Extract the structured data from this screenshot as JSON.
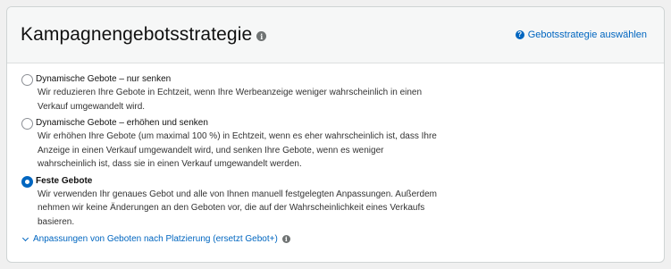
{
  "header": {
    "title": "Kampagnengebotsstrategie",
    "title_info_icon": "info-icon",
    "help_link": "Gebotsstrategie auswählen",
    "help_icon": "question-icon"
  },
  "options": [
    {
      "label": "Dynamische Gebote – nur senken",
      "selected": false,
      "description": "Wir reduzieren Ihre Gebote in Echtzeit, wenn Ihre Werbeanzeige weniger wahrscheinlich in einen Verkauf umgewandelt wird."
    },
    {
      "label": "Dynamische Gebote – erhöhen und senken",
      "selected": false,
      "description": "Wir erhöhen Ihre Gebote (um maximal 100 %) in Echtzeit, wenn es eher wahrscheinlich ist, dass Ihre Anzeige in einen Verkauf umgewandelt wird, und senken Ihre Gebote, wenn es weniger wahrscheinlich ist, dass sie in einen Verkauf umgewandelt werden."
    },
    {
      "label": "Feste Gebote",
      "selected": true,
      "description": "Wir verwenden Ihr genaues Gebot und alle von Ihnen manuell festgelegten Anpassungen. Außerdem nehmen wir keine Änderungen an den Geboten vor, die auf der Wahrscheinlichkeit eines Verkaufs basieren."
    }
  ],
  "expander": {
    "label": "Anpassungen von Geboten nach Platzierung (ersetzt Gebot+)",
    "chevron_icon": "chevron-down-icon",
    "info_icon": "info-icon"
  },
  "colors": {
    "accent": "#0066c0",
    "header_bg": "#f6f7f7",
    "page_bg": "#f0f0f0"
  }
}
